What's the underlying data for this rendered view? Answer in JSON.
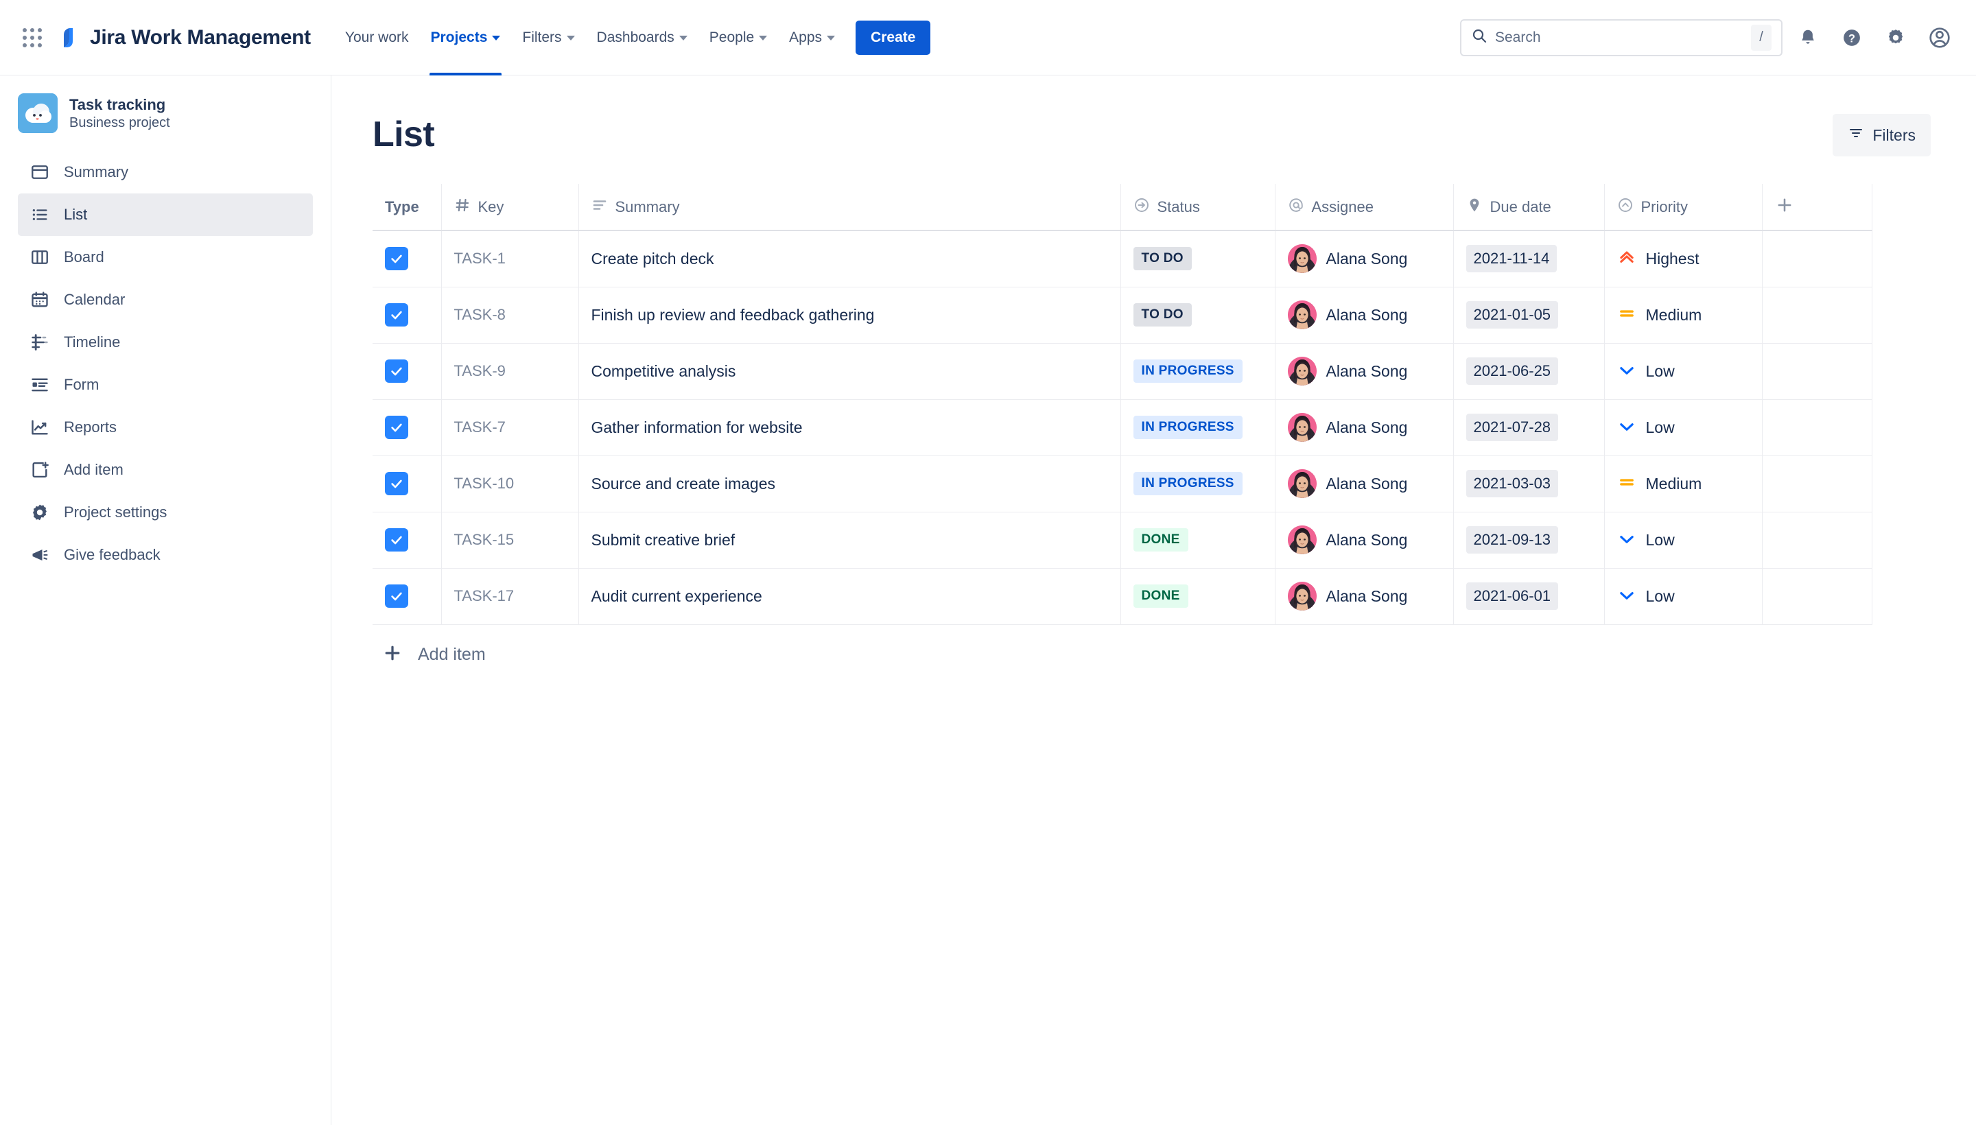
{
  "topnav": {
    "app_switcher": "apps-grid-icon",
    "brand": "Jira Work Management",
    "items": [
      {
        "label": "Your work",
        "has_caret": false,
        "active": false
      },
      {
        "label": "Projects",
        "has_caret": true,
        "active": true
      },
      {
        "label": "Filters",
        "has_caret": true,
        "active": false
      },
      {
        "label": "Dashboards",
        "has_caret": true,
        "active": false
      },
      {
        "label": "People",
        "has_caret": true,
        "active": false
      },
      {
        "label": "Apps",
        "has_caret": true,
        "active": false
      }
    ],
    "create_label": "Create",
    "search": {
      "placeholder": "Search",
      "shortcut": "/"
    },
    "right_icons": [
      "notifications-bell-icon",
      "help-question-icon",
      "settings-gear-icon",
      "user-avatar-icon"
    ],
    "accent_color": "#0052cc",
    "create_button_color": "#0c5ad4"
  },
  "sidebar": {
    "project": {
      "name": "Task tracking",
      "type": "Business project",
      "icon": "cloud-smiley-icon",
      "icon_bg": "#5aaee6"
    },
    "items": [
      {
        "label": "Summary",
        "icon": "summary-window-icon",
        "selected": false
      },
      {
        "label": "List",
        "icon": "list-bullets-icon",
        "selected": true
      },
      {
        "label": "Board",
        "icon": "board-columns-icon",
        "selected": false
      },
      {
        "label": "Calendar",
        "icon": "calendar-icon",
        "selected": false
      },
      {
        "label": "Timeline",
        "icon": "timeline-icon",
        "selected": false
      },
      {
        "label": "Form",
        "icon": "form-icon",
        "selected": false
      },
      {
        "label": "Reports",
        "icon": "reports-chart-icon",
        "selected": false
      },
      {
        "label": "Add item",
        "icon": "add-item-page-icon",
        "selected": false
      },
      {
        "label": "Project settings",
        "icon": "settings-gear-icon",
        "selected": false
      },
      {
        "label": "Give feedback",
        "icon": "megaphone-icon",
        "selected": false
      }
    ]
  },
  "main": {
    "title": "List",
    "filters_button": {
      "label": "Filters",
      "icon": "filter-icon"
    },
    "add_column_icon": "plus-icon",
    "add_item_row": {
      "label": "Add item",
      "icon": "plus-icon"
    }
  },
  "table": {
    "columns": [
      {
        "key": "type",
        "label": "Type",
        "icon": null
      },
      {
        "key": "key",
        "label": "Key",
        "icon": "hash-icon"
      },
      {
        "key": "summary",
        "label": "Summary",
        "icon": "lines-icon"
      },
      {
        "key": "status",
        "label": "Status",
        "icon": "arrow-circle-icon"
      },
      {
        "key": "assignee",
        "label": "Assignee",
        "icon": "at-icon"
      },
      {
        "key": "due_date",
        "label": "Due date",
        "icon": "tag-icon"
      },
      {
        "key": "priority",
        "label": "Priority",
        "icon": "chevron-circle-up-icon"
      }
    ],
    "rows": [
      {
        "type_icon": "task-check-icon",
        "key": "TASK-1",
        "summary": "Create pitch deck",
        "status": "TO DO",
        "status_kind": "todo",
        "assignee": "Alana Song",
        "due_date": "2021-11-14",
        "priority": "Highest",
        "priority_kind": "highest"
      },
      {
        "type_icon": "task-check-icon",
        "key": "TASK-8",
        "summary": "Finish up review and feedback gathering",
        "status": "TO DO",
        "status_kind": "todo",
        "assignee": "Alana Song",
        "due_date": "2021-01-05",
        "priority": "Medium",
        "priority_kind": "medium"
      },
      {
        "type_icon": "task-check-icon",
        "key": "TASK-9",
        "summary": "Competitive analysis",
        "status": "IN PROGRESS",
        "status_kind": "prog",
        "assignee": "Alana Song",
        "due_date": "2021-06-25",
        "priority": "Low",
        "priority_kind": "low"
      },
      {
        "type_icon": "task-check-icon",
        "key": "TASK-7",
        "summary": "Gather information for website",
        "status": "IN PROGRESS",
        "status_kind": "prog",
        "assignee": "Alana Song",
        "due_date": "2021-07-28",
        "priority": "Low",
        "priority_kind": "low"
      },
      {
        "type_icon": "task-check-icon",
        "key": "TASK-10",
        "summary": "Source and create images",
        "status": "IN PROGRESS",
        "status_kind": "prog",
        "assignee": "Alana Song",
        "due_date": "2021-03-03",
        "priority": "Medium",
        "priority_kind": "medium"
      },
      {
        "type_icon": "task-check-icon",
        "key": "TASK-15",
        "summary": "Submit creative brief",
        "status": "DONE",
        "status_kind": "done",
        "assignee": "Alana Song",
        "due_date": "2021-09-13",
        "priority": "Low",
        "priority_kind": "low"
      },
      {
        "type_icon": "task-check-icon",
        "key": "TASK-17",
        "summary": "Audit current experience",
        "status": "DONE",
        "status_kind": "done",
        "assignee": "Alana Song",
        "due_date": "2021-06-01",
        "priority": "Low",
        "priority_kind": "low"
      }
    ]
  },
  "colors": {
    "task_blue": "#2684ff",
    "status_todo_bg": "#dfe1e6",
    "status_progress_bg": "#deebff",
    "status_progress_fg": "#0052cc",
    "status_done_bg": "#e3fcef",
    "status_done_fg": "#006644",
    "priority_highest": "#ff5630",
    "priority_medium": "#ffab00",
    "priority_low": "#0065ff"
  }
}
